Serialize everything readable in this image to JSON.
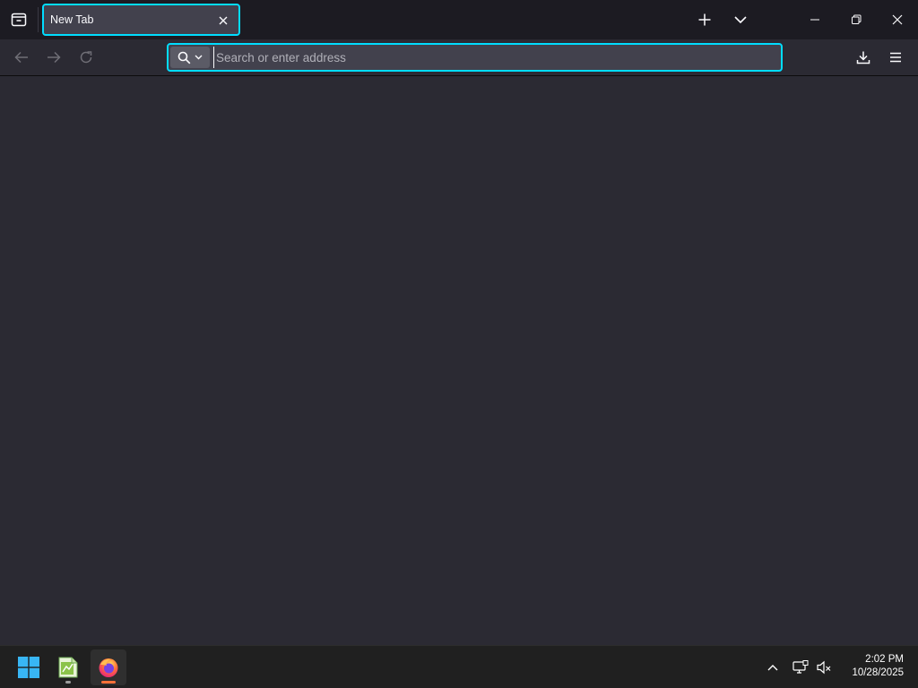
{
  "browser": {
    "tab": {
      "title": "New Tab"
    },
    "urlbar": {
      "placeholder": "Search or enter address",
      "value": ""
    }
  },
  "icons": {
    "tab_list": "tab-list-icon",
    "tab_close": "close-icon",
    "new_tab": "plus-icon",
    "all_tabs": "chevron-down-icon",
    "minimize": "minimize-icon",
    "restore": "restore-icon",
    "close_window": "close-icon",
    "back": "back-arrow-icon",
    "forward": "forward-arrow-icon",
    "reload": "reload-icon",
    "search": "search-icon",
    "downloads": "download-icon",
    "menu": "hamburger-menu-icon"
  },
  "colors": {
    "accent": "#00ddff",
    "tabstrip_bg": "#1c1b22",
    "toolbar_bg": "#2b2a33",
    "firefox_orange": "#ff7139"
  },
  "taskbar": {
    "clock": {
      "time": "2:02 PM",
      "date": "10/28/2025"
    }
  }
}
